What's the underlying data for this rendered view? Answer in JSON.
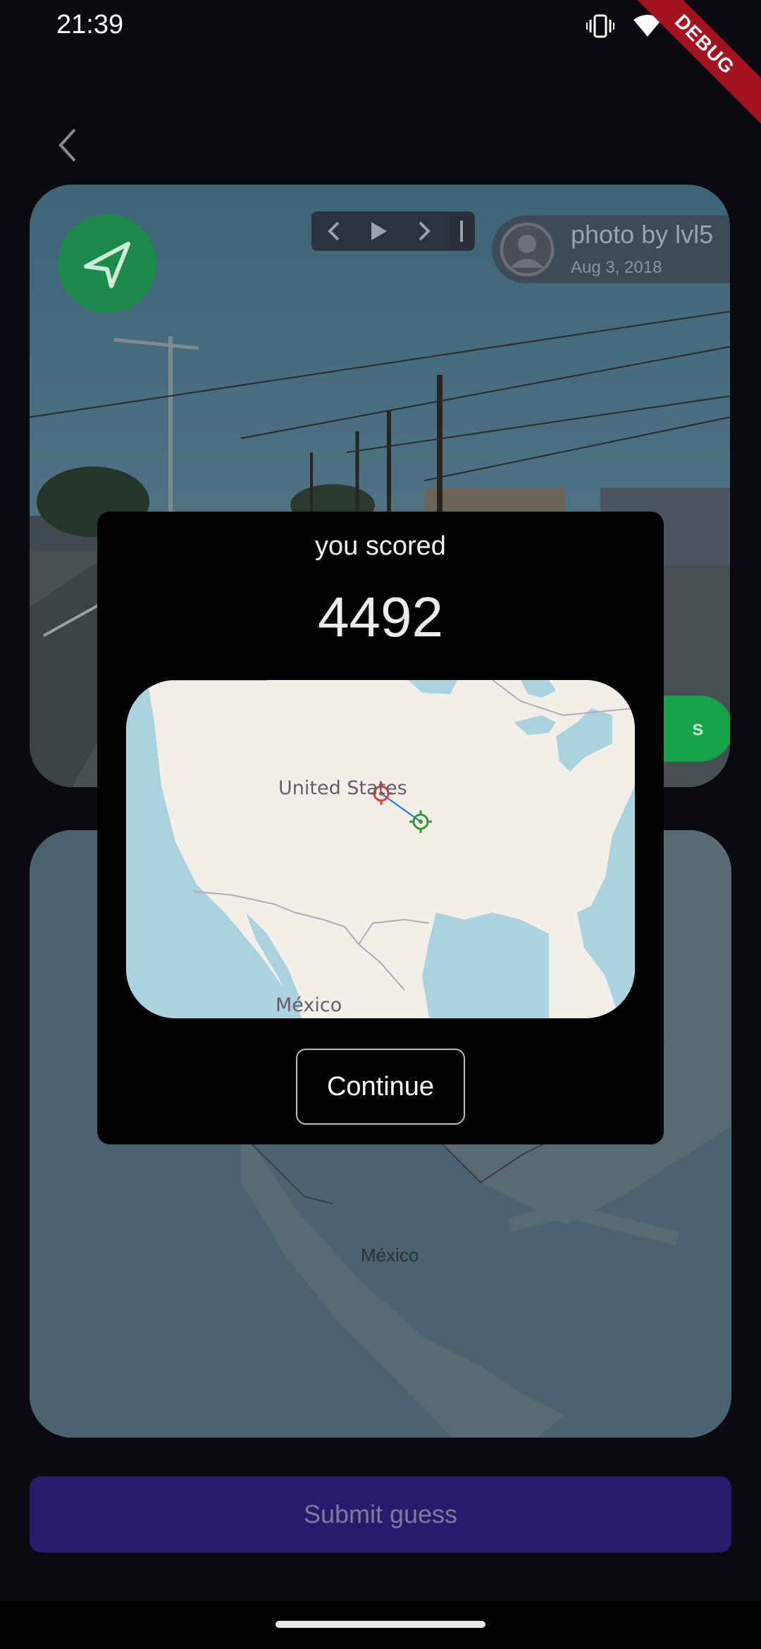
{
  "status_bar": {
    "time": "21:39",
    "debug_label": "DEBUG",
    "icons": [
      "vibrate-icon",
      "wifi-icon",
      "battery-icon"
    ]
  },
  "back": {
    "icon": "chevron-left-icon"
  },
  "photo": {
    "credit_name": "photo by lvl5",
    "credit_date": "Aug 3, 2018",
    "action_label": "s",
    "controls": [
      "chevron-left-icon",
      "play-icon",
      "chevron-right-icon",
      "end-icon"
    ],
    "compass_icon": "compass-arrow-icon",
    "compass_color": "#1c8a4a",
    "action_color": "#16a34a"
  },
  "guess_map": {
    "labels": {
      "mexico": "México"
    }
  },
  "submit": {
    "label": "Submit guess",
    "color": "#2a1a6e"
  },
  "score_dialog": {
    "caption": "you scored",
    "score": "4492",
    "map_labels": {
      "country": "United States",
      "mexico": "México"
    },
    "markers": {
      "guess_color": "#e53935",
      "actual_color": "#2e9b2e",
      "line_color": "#1e6fd9"
    },
    "continue_label": "Continue"
  }
}
